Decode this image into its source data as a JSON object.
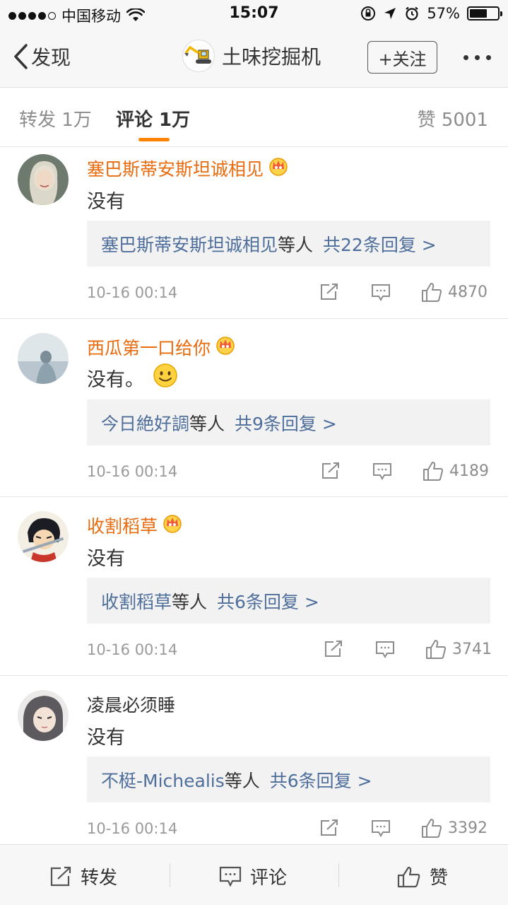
{
  "status_bar": {
    "carrier": "中国移动",
    "time": "15:07",
    "battery": "57%"
  },
  "nav": {
    "back_label": "发现",
    "title": "土味挖掘机",
    "follow_label": "+关注"
  },
  "tabs": {
    "repost": "转发 1万",
    "comment": "评论 1万",
    "likes": "赞 5001"
  },
  "comments": [
    {
      "name": "塞巴斯蒂安斯坦诚相见",
      "text": "没有",
      "reply_who": "塞巴斯蒂安斯坦诚相见",
      "reply_mid": "等人",
      "reply_count": "共22条回复 >",
      "time": "10-16 00:14",
      "likes": "4870"
    },
    {
      "name": "西瓜第一口给你",
      "text": "没有。",
      "reply_who": "今日絶好調",
      "reply_mid": "等人",
      "reply_count": "共9条回复 >",
      "time": "10-16 00:14",
      "likes": "4189"
    },
    {
      "name": "收割稻草",
      "text": "没有",
      "reply_who": "收割稻草",
      "reply_mid": "等人",
      "reply_count": "共6条回复 >",
      "time": "10-16 00:14",
      "likes": "3741"
    },
    {
      "name": "凌晨必须睡",
      "text": "没有",
      "reply_who": "不梃-Michealis",
      "reply_mid": "等人",
      "reply_count": "共6条回复 >",
      "time": "10-16 00:14",
      "likes": "3392"
    }
  ],
  "bottom_bar": {
    "repost": "转发",
    "comment": "评论",
    "like": "赞"
  },
  "colors": {
    "accent": "#ff8200",
    "vip_name": "#e86b0f",
    "link": "#4e6e9c"
  }
}
